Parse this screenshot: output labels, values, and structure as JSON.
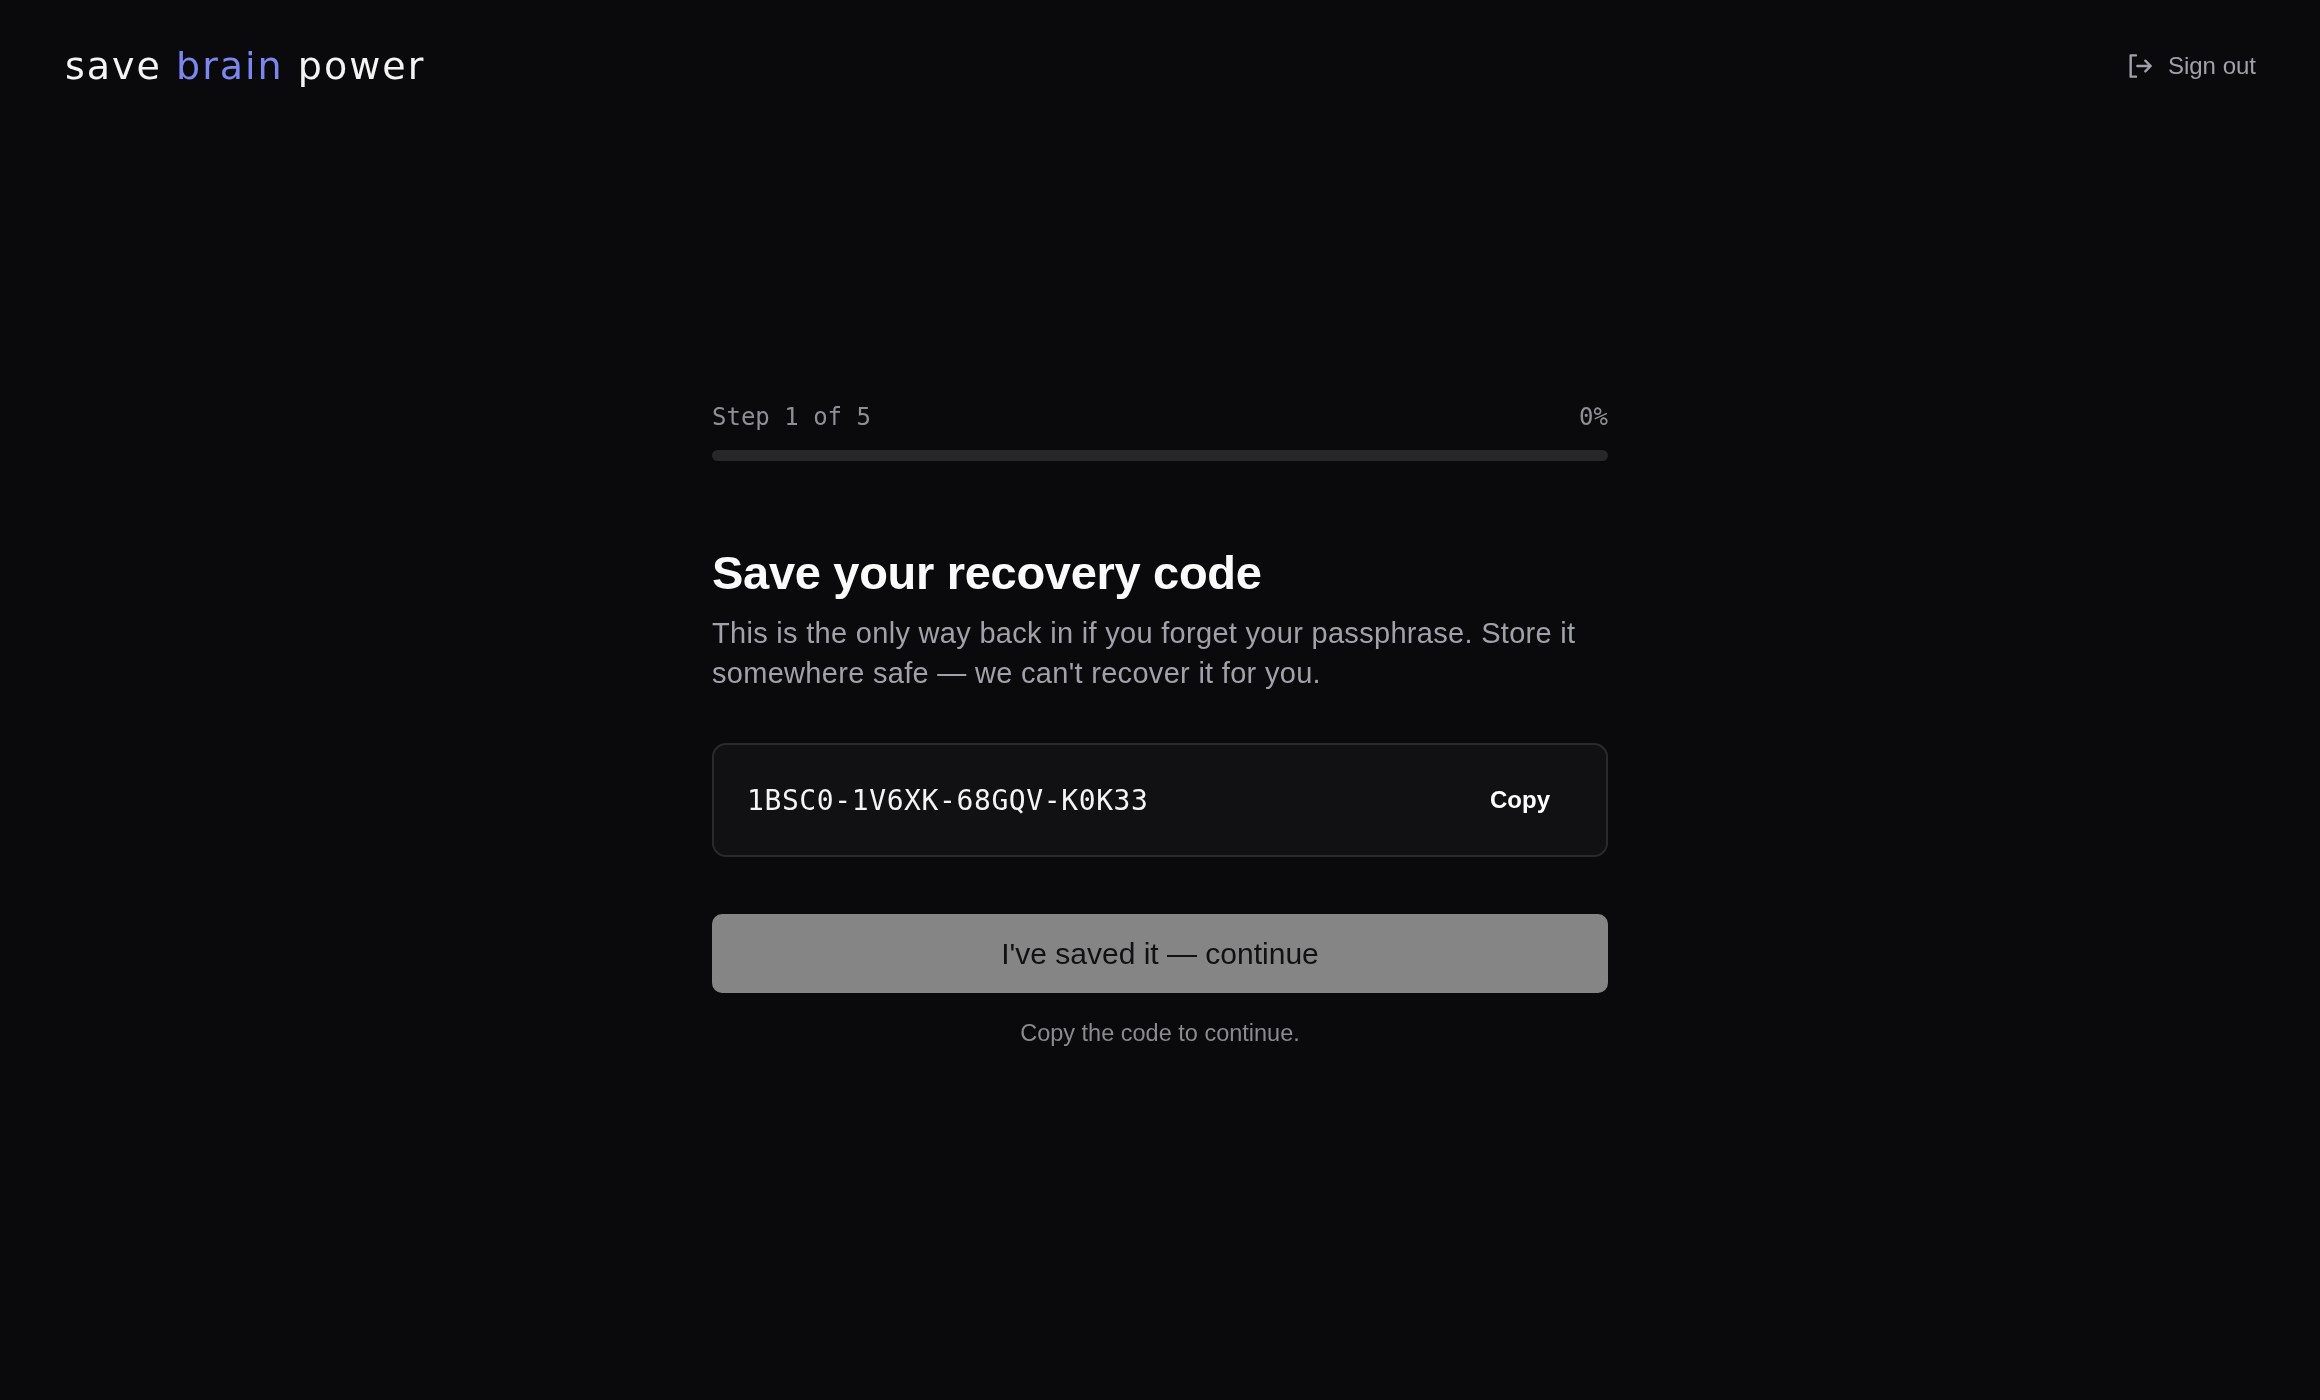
{
  "header": {
    "logo": {
      "parts": [
        {
          "text": "save",
          "highlighted": false
        },
        {
          "text": "brain",
          "highlighted": true
        },
        {
          "text": "power",
          "highlighted": false
        }
      ]
    },
    "sign_out": {
      "label": "Sign out"
    }
  },
  "progress": {
    "step_label": "Step 1 of 5",
    "percent": "0%",
    "level": 0
  },
  "title": "Save your recovery code",
  "description": "This is the only way back in if you forget your passphrase. Store it somewhere safe — we can't recover it for you.",
  "recovery_code": {
    "value": "1BSC0-1V6XK-68GQV-K0K33",
    "copy_label": "Copy"
  },
  "continue_button": {
    "label": "I've saved it — continue",
    "disabled": true
  },
  "hint": "Copy the code to continue."
}
